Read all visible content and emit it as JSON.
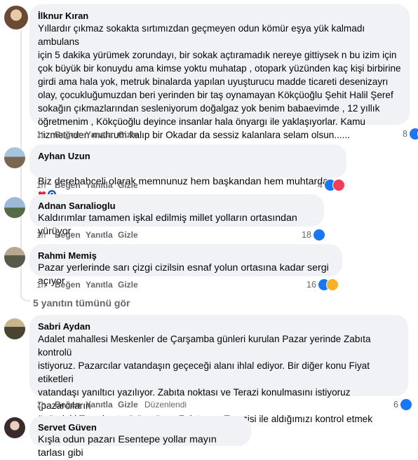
{
  "comments": [
    {
      "name": "İlknur Kıran",
      "text": "Yıllardır çıkmaz sokakta sırtımızdan geçmeyen odun kömür eşya yük kalmadı ambulans\niçin 5 dakika yürümek zorundayı, bir sokak açtıramadık nereye gittiysek n bu izim için\nçok büyük bir konuydu ama kimse yoktu muhatap , otopark yüzünden kaç kişi birbirine\ngirdi ama hala yok, metruk binalarda yapılan uyuşturucu madde ticareti desenizayrı\nolay, çocukluğumuzdan beri yerinden bir taş oynamayan Kökçüoğlu Şehit Halil Şeref\nsokağın çıkmazlarından sesleniyorum doğalgaz yok benim babaevimde , 12 yıllık\nöğretmenim , Kökçüoğlu deyince insanlar hala önyargı ile yaklaşıyorlar. Kamu\nhizmetinden mahrum kalıp bir Okadar da sessiz kalanlara selam olsun......",
      "time": "1h",
      "like": "Beğen",
      "reply": "Yanıtla",
      "hide": "Gizle",
      "reactions": "8"
    },
    {
      "name": "Ayhan Uzun",
      "text": "Biz derebahceli olarak memnunuz hem başkandan hem muhtardan",
      "time": "1h",
      "like": "Beğen",
      "reply": "Yanıtla",
      "hide": "Gizle",
      "reactions": "4"
    },
    {
      "name": "Adnan Sarıalioglu",
      "text": "Kaldırımlar tamamen işkal edilmiş millet yolların ortasından yürüyor.",
      "time": "1h",
      "like": "Beğen",
      "reply": "Yanıtla",
      "hide": "Gizle",
      "reactions": "18"
    },
    {
      "name": "Rahmi Memiş",
      "text": "Pazar yerlerinde sarı çizgi cizilsin esnaf yolun ortasına kadar sergi açıyor",
      "time": "1h",
      "like": "Beğen",
      "reply": "Yanıtla",
      "hide": "Gizle",
      "reactions": "16"
    },
    {
      "name": "Sabri Aydan",
      "text": "Adalet mahallesi Meskenler de Çarşamba günleri kurulan Pazar yerinde Zabıta kontrolü\nistiyoruz. Pazarcılar vatandaşın geçeceği alanı ihlal ediyor. Bir diğer konu Fiyat etiketleri\nvatandaşı yanıltıcı yazılıyor. Zabıta noktası ve Terazi konulmasını istiyoruz (pazarcıların\nönündeki Terazi net görünmüyor. Zabıta nın Terazisi ile aldığımızı kontrol etmek\nistiyoruz.)",
      "time": "1h",
      "like": "Beğen",
      "reply": "Yanıtla",
      "hide": "Gizle",
      "edited": "Düzenlendi",
      "reactions": "6"
    },
    {
      "name": "Servet Güven",
      "text": "Kışla odun pazarı Esentepe yollar mayın tarlası gibi"
    }
  ],
  "view_more_replies": "5 yanıtın tümünü gör",
  "icons": [
    "like-icon",
    "love-icon",
    "haha-icon",
    "heart-emoji",
    "evil-eye-emoji"
  ],
  "colors": {
    "like": "#1877f2",
    "love": "#f33e58",
    "haha": "#f7b125",
    "bubble": "#f0f2f5",
    "meta": "#65676b"
  }
}
